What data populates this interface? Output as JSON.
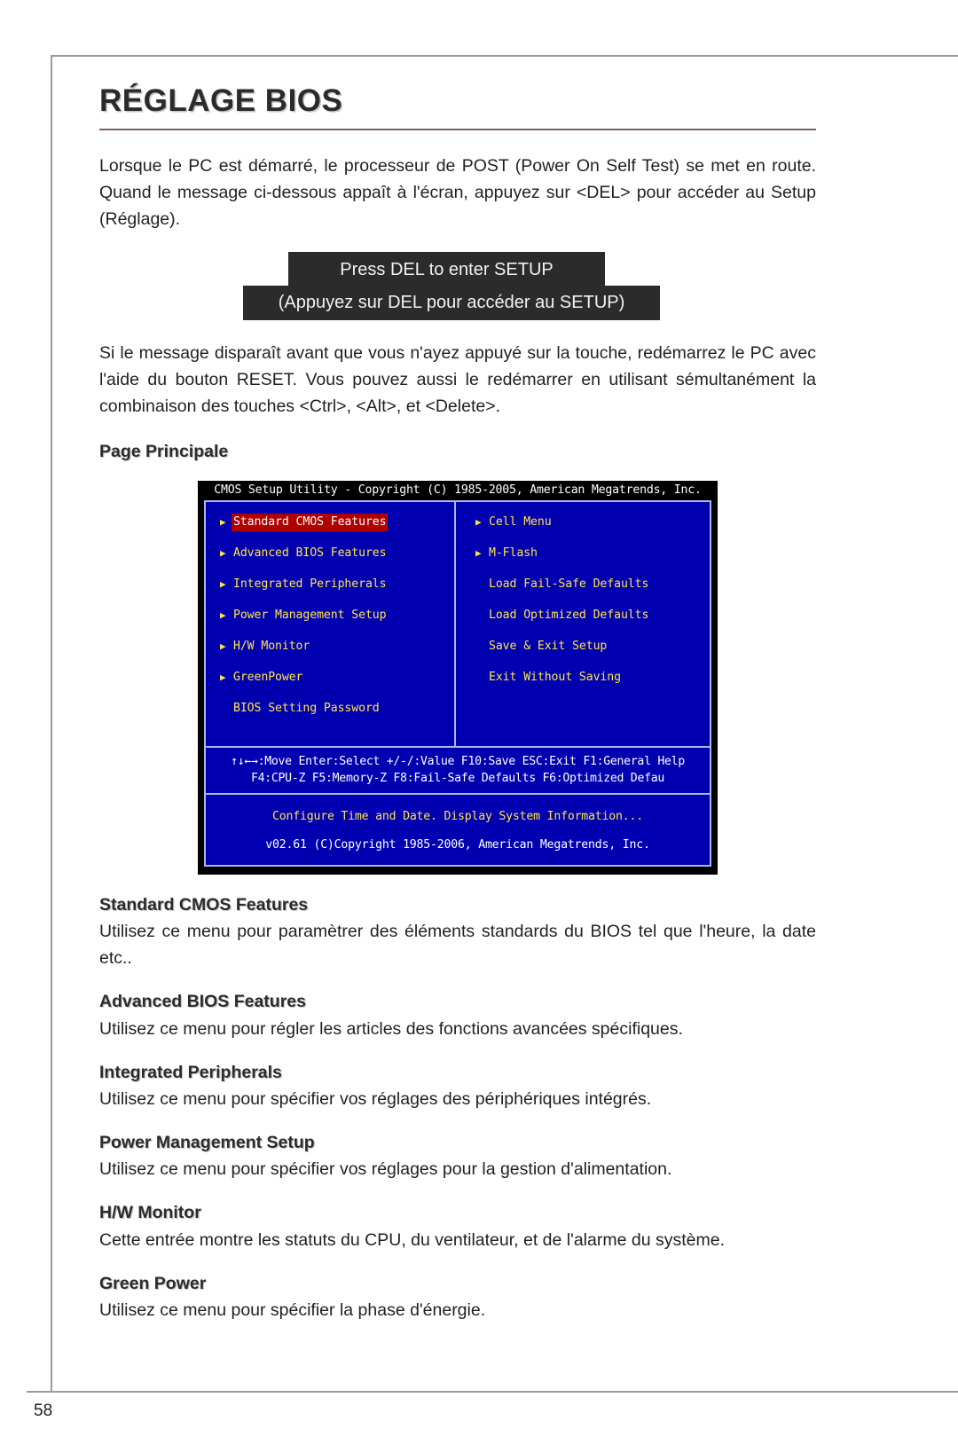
{
  "page": {
    "number": "58",
    "title": "RÉGLAGE BIOS"
  },
  "intro": {
    "paragraph_1": "Lorsque le PC est démarré, le processeur de POST (Power On Self Test) se met en route. Quand le message ci-dessous appaît à l'écran, appuyez sur <DEL> pour accéder au Setup (Réglage).",
    "paragraph_2": "Si le message disparaît avant que vous n'ayez appuyé sur la touche, redémarrez le PC avec l'aide du bouton RESET. Vous pouvez aussi le redémarrer en utilisant sémultanément la combinaison des touches <Ctrl>, <Alt>, et <Delete>."
  },
  "message_box": {
    "line_1": "Press DEL to enter SETUP",
    "line_2": "(Appuyez sur DEL pour accéder au SETUP)"
  },
  "main_page_heading": "Page Principale",
  "bios": {
    "titlebar": "CMOS Setup Utility - Copyright (C) 1985-2005, American Megatrends, Inc.",
    "menu_left": [
      {
        "label": "Standard CMOS Features",
        "arrow": true,
        "selected": true
      },
      {
        "label": "Advanced BIOS Features",
        "arrow": true,
        "selected": false
      },
      {
        "label": "Integrated Peripherals",
        "arrow": true,
        "selected": false
      },
      {
        "label": "Power Management Setup",
        "arrow": true,
        "selected": false
      },
      {
        "label": "H/W Monitor",
        "arrow": true,
        "selected": false
      },
      {
        "label": "GreenPower",
        "arrow": true,
        "selected": false
      },
      {
        "label": "BIOS Setting Password",
        "arrow": false,
        "selected": false
      }
    ],
    "menu_right": [
      {
        "label": "Cell Menu",
        "arrow": true,
        "selected": false
      },
      {
        "label": "M-Flash",
        "arrow": true,
        "selected": false
      },
      {
        "label": "Load Fail-Safe Defaults",
        "arrow": false,
        "selected": false
      },
      {
        "label": "Load Optimized Defaults",
        "arrow": false,
        "selected": false
      },
      {
        "label": "Save & Exit Setup",
        "arrow": false,
        "selected": false
      },
      {
        "label": "Exit Without Saving",
        "arrow": false,
        "selected": false
      }
    ],
    "keys_line_1": "↑↓←→:Move  Enter:Select  +/-/:Value  F10:Save  ESC:Exit  F1:General Help",
    "keys_line_2": "F4:CPU-Z     F5:Memory-Z     F8:Fail-Safe Defaults     F6:Optimized Defau",
    "help_line": "Configure Time and Date.  Display System Information...",
    "version_line": "v02.61 (C)Copyright 1985-2006, American Megatrends, Inc.",
    "colors": {
      "background": "#0000b0",
      "titlebar_background": "#000000",
      "item_text": "#ffe34d",
      "selected_background": "#b00000",
      "border": "#a8b8e8"
    }
  },
  "sections": [
    {
      "heading": "Standard CMOS Features",
      "body": "Utilisez ce menu pour paramètrer des éléments standards du BIOS tel que l'heure, la date etc.."
    },
    {
      "heading": "Advanced BIOS Features",
      "body": "Utilisez ce menu pour régler les articles des fonctions avancées spécifiques."
    },
    {
      "heading": "Integrated Peripherals",
      "body": "Utilisez ce menu pour spécifier vos réglages des périphériques intégrés."
    },
    {
      "heading": "Power Management Setup",
      "body": "Utilisez ce menu pour spécifier vos réglages pour la gestion d'alimentation."
    },
    {
      "heading": "H/W Monitor",
      "body": "Cette entrée montre les statuts du CPU, du ventilateur, et de l'alarme du système."
    },
    {
      "heading": "Green Power",
      "body": "Utilisez ce menu pour spécifier la phase d'énergie."
    }
  ]
}
